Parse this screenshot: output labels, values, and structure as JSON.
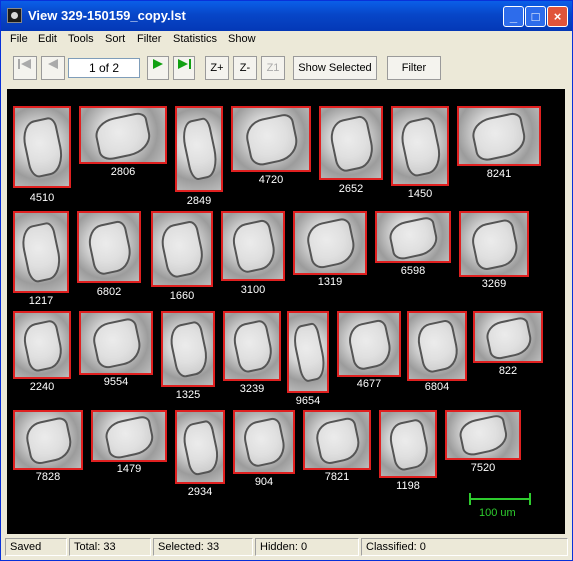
{
  "window": {
    "title": "View  329-150159_copy.lst"
  },
  "menu": [
    "File",
    "Edit",
    "Tools",
    "Sort",
    "Filter",
    "Statistics",
    "Show"
  ],
  "toolbar": {
    "page": "1 of 2",
    "zoom_in": "Z+",
    "zoom_out": "Z-",
    "zoom_1": "Z1",
    "show_selected": "Show Selected",
    "filter": "Filter"
  },
  "colors": {
    "highlight": "#E02020",
    "scale": "#2ECC2E"
  },
  "particles": [
    "4510",
    "2806",
    "2849",
    "4720",
    "2652",
    "1450",
    "8241",
    "1217",
    "6802",
    "1660",
    "3100",
    "1319",
    "6598",
    "3269",
    "2240",
    "9554",
    "1325",
    "3239",
    "9654",
    "4677",
    "6804",
    "822",
    "7828",
    "1479",
    "2934",
    "904",
    "7821",
    "1198",
    "7520"
  ],
  "scale_bar": "100 um",
  "status": {
    "state": "Saved",
    "total": "Total:  33",
    "selected": "Selected:  33",
    "hidden": "Hidden:  0",
    "classified": "Classified:  0"
  }
}
